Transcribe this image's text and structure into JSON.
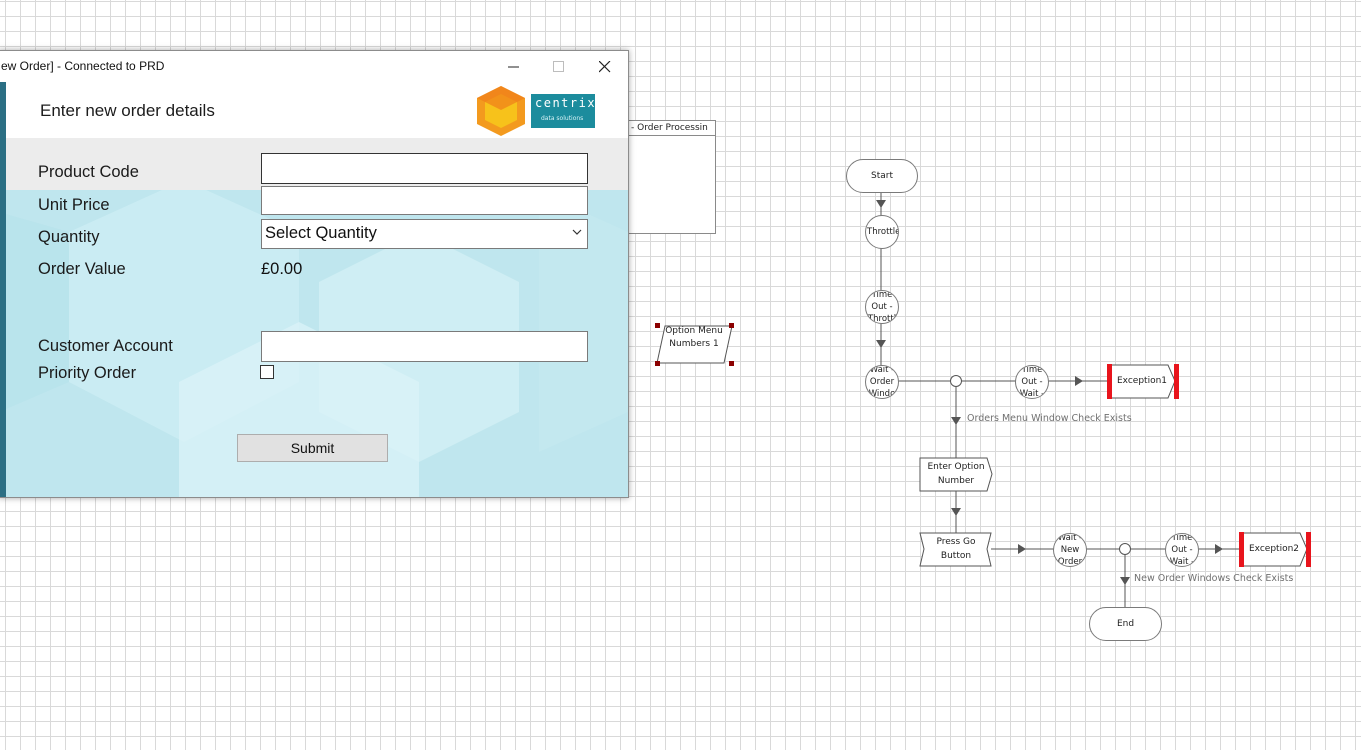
{
  "window": {
    "title": "ew Order] - Connected to PRD",
    "minimize_glyph": "–",
    "maximize_glyph": "☐",
    "close_glyph": "✕"
  },
  "form": {
    "heading": "Enter new order details",
    "logo": {
      "word": "centrix",
      "sub": "data solutions"
    },
    "labels": {
      "product_code": "Product Code",
      "unit_price": "Unit Price",
      "quantity": "Quantity",
      "order_value": "Order Value",
      "customer_account": "Customer Account",
      "priority_order": "Priority Order"
    },
    "values": {
      "product_code": "",
      "unit_price": "",
      "quantity_selected": "Select Quantity",
      "order_value": "£0.00",
      "customer_account": "",
      "priority_order_checked": false
    },
    "submit_label": "Submit"
  },
  "background_stage": {
    "title": "- Order Processin"
  },
  "flowchart": {
    "option_menu": "Option Menu Numbers 1",
    "start": "Start",
    "throttle": "Throttle",
    "timeout_throttle": "Time Out - Throttl",
    "wait_order_window": "Wait - Order Windo",
    "timeout_wait1": "Time Out - Wait -",
    "exception1": "Exception1",
    "orders_menu_label": "Orders Menu Window Check Exists",
    "enter_option_number": "Enter Option Number",
    "press_go_button": "Press Go Button",
    "wait_new_order": "Wait - New Order",
    "timeout_wait2": "Time Out - Wait -",
    "exception2": "Exception2",
    "new_order_label": "New Order Windows Check Exists",
    "end": "End"
  },
  "colors": {
    "accent_bar": "#2b6f84",
    "form_background": "#bfe6ee",
    "exception_marker": "#e8141c",
    "logo_teal": "#1c8c9d",
    "logo_orange": "#f39a1e"
  }
}
